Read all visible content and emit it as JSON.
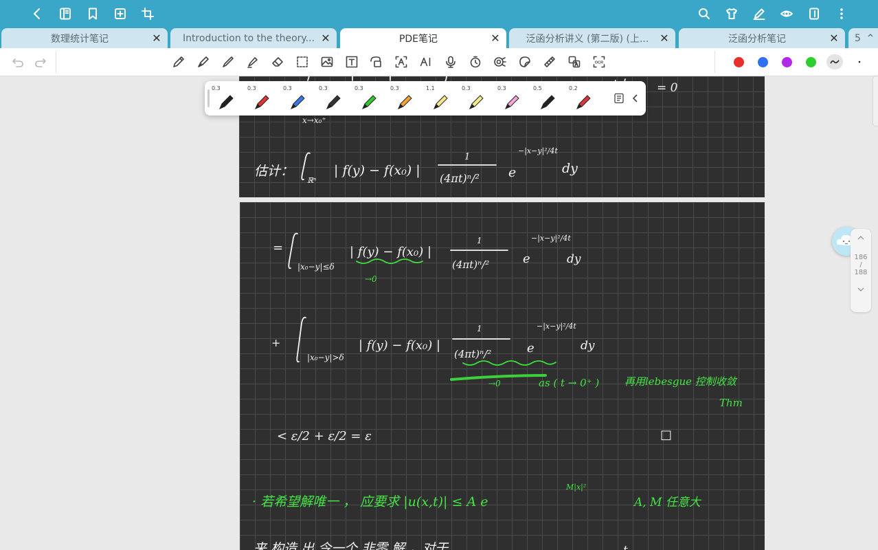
{
  "tabs": [
    {
      "label": "数理统计笔记"
    },
    {
      "label": "Introduction to the theory..."
    },
    {
      "label": "PDE笔记"
    },
    {
      "label": "泛函分析讲义 (第二版) (上..."
    },
    {
      "label": "泛函分析笔记"
    }
  ],
  "tab_count": "5",
  "pen_sizes": [
    "0.3",
    "0.3",
    "0.3",
    "0.3",
    "0.3",
    "0.3",
    "1.1",
    "0.3",
    "0.3",
    "0.5",
    "0.2"
  ],
  "pen_colors": [
    "#222222",
    "#e0343b",
    "#3a78e6",
    "#333333",
    "#32c632",
    "#f0a531",
    "#f6e58a",
    "#f3ec8a",
    "#f3a6d6",
    "#222222",
    "#d9343a"
  ],
  "swatches": [
    "#e8302a",
    "#2f6ff2",
    "#b128e8",
    "#2ccf2c"
  ],
  "pager": {
    "current": "186",
    "sep": "/",
    "total": "188"
  },
  "note": {
    "limit_sub": "x→x₀⁺",
    "eq_zero": "= 0",
    "estimate_label": "估计：",
    "integrand": "| f(y) − f(x₀) |",
    "kernel_num": "1",
    "kernel_den": "(4πt)ⁿ/²",
    "exp_base": "e",
    "exp_sup": "−|x−y|²/4t",
    "dy": "dy",
    "domain_rn": "ℝⁿ",
    "line1_sub": "|x₀−y|≤δ",
    "line1_green": "→0",
    "line2_sub": "|x₀−y|>δ",
    "line2_green": "→0",
    "as_text": "as ( t → 0⁺ )",
    "lebesgue": "再用lebesgue 控制收敛",
    "thm": "Thm",
    "epsilon_line": "<  ε/2 + ε/2 = ε",
    "qed": "□",
    "uniq_line": "· 若希望解唯一 ，   应要求 |u(x,t)| ≤  A e",
    "uniq_sup": "M|x|²",
    "am_text": "A, M 任意大",
    "bottom_line": "来 构造 出 令一个 非零 解 ，对于",
    "bottom_t": "t"
  }
}
